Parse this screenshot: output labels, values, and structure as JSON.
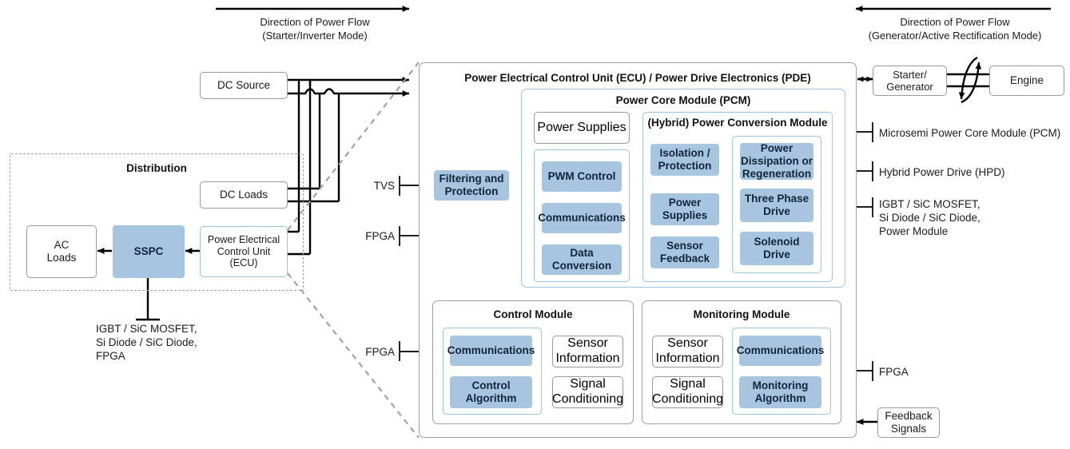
{
  "diagram": {
    "flow_left": {
      "line1": "Direction of Power Flow",
      "line2": "(Starter/Inverter Mode)",
      "arrow": "right-arrow-icon"
    },
    "flow_right": {
      "line1": "Direction of Power Flow",
      "line2": "(Generator/Active Rectification Mode)",
      "arrow": "left-arrow-icon"
    },
    "left_side": {
      "dc_source": "DC Source",
      "distribution_title": "Distribution",
      "dc_loads": "DC Loads",
      "ac_loads_l1": "AC",
      "ac_loads_l2": "Loads",
      "sspc": "SSPC",
      "ecu_small_l1": "Power Electrical",
      "ecu_small_l2": "Control Unit",
      "ecu_small_l3": "(ECU)",
      "sspc_note_l1": "IGBT / SiC MOSFET,",
      "sspc_note_l2": "Si Diode / SiC Diode,",
      "sspc_note_l3": "FPGA"
    },
    "callouts_left": {
      "tvs": "TVS",
      "fpga_pcm": "FPGA",
      "fpga_control": "FPGA"
    },
    "ecu": {
      "title": "Power Electrical Control Unit (ECU) / Power Drive Electronics (PDE)",
      "filtering_l1": "Filtering and",
      "filtering_l2": "Protection",
      "pcm": {
        "title": "Power Core Module (PCM)",
        "power_supplies": "Power Supplies",
        "left_group": [
          "PWM Control",
          "Communications",
          "Data Conversion"
        ],
        "hpcm": {
          "title": "(Hybrid) Power Conversion Module",
          "col1": [
            "Isolation / Protection",
            "Power Supplies",
            "Sensor Feedback"
          ],
          "col2": [
            "Power Dissipation or Regeneration",
            "Three Phase Drive",
            "Solenoid Drive"
          ]
        }
      },
      "control_module": {
        "title": "Control Module",
        "blue": [
          "Communications",
          "Control Algorithm"
        ],
        "white": [
          "Sensor Information",
          "Signal Conditioning"
        ]
      },
      "monitoring_module": {
        "title": "Monitoring Module",
        "white": [
          "Sensor Information",
          "Signal Conditioning"
        ],
        "blue": [
          "Communications",
          "Monitoring Algorithm"
        ]
      }
    },
    "right_side": {
      "starter_l1": "Starter/",
      "starter_l2": "Generator",
      "engine": "Engine",
      "callout_pcm": "Microsemi Power Core Module (PCM)",
      "callout_hpd": "Hybrid Power Drive (HPD)",
      "callout_igbt_l1": "IGBT / SiC MOSFET,",
      "callout_igbt_l2": "Si Diode / SiC Diode,",
      "callout_igbt_l3": "Power Module",
      "callout_fpga": "FPGA",
      "feedback_l1": "Feedback",
      "feedback_l2": "Signals"
    },
    "colors": {
      "blue_fill": "#a7c5e0",
      "blue_border": "#9fc3e0",
      "gray_border": "#9a9a9a",
      "dashed_border": "#a3a3a3",
      "wire": "#000000"
    }
  }
}
